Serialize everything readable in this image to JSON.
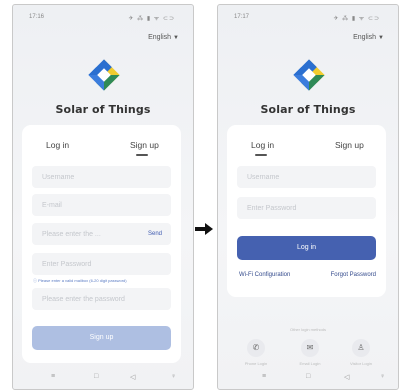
{
  "left_screen": {
    "status_time": "17:16",
    "status_icons": "✈ ⁂ ▮ ᯤ ⊂⊃",
    "language": "English",
    "app_name": "Solar of Things",
    "tabs": {
      "login": "Log in",
      "signup": "Sign up"
    },
    "fields": {
      "username": "Username",
      "email": "E-mail",
      "verification_code": "Please enter the ...",
      "send": "Send",
      "password": "Enter Password",
      "confirm_password": "Please enter the password"
    },
    "hint": "Please enter a valid mailbox (6-20 digit password)",
    "signup_button": "Sign up",
    "nav": {
      "menu": "≡",
      "home": "□",
      "back": "◁",
      "accessibility": "♀"
    }
  },
  "right_screen": {
    "status_time": "17:17",
    "status_icons": "✈ ⁂ ▮ ᯤ ⊂⊃",
    "language": "English",
    "app_name": "Solar of Things",
    "tabs": {
      "login": "Log in",
      "signup": "Sign up"
    },
    "fields": {
      "username": "Username",
      "password": "Enter Password"
    },
    "login_button": "Log in",
    "wifi_config": "Wi-Fi Configuration",
    "forgot_password": "Forgot Password",
    "other_methods": "Other login methods",
    "quick": {
      "phone": "Phone Login",
      "email": "Email Login",
      "visitor": "Visitor Login"
    },
    "nav": {
      "menu": "≡",
      "home": "□",
      "back": "◁",
      "accessibility": "♀"
    }
  },
  "colors": {
    "primary": "#4561b0",
    "primary_light": "#aebfe2",
    "logo_yellow": "#f1cc2f",
    "logo_blue": "#3b7ddd",
    "logo_green": "#2f8a57"
  },
  "icons": {
    "logo": "solar-of-things-logo",
    "arrow": "right-arrow",
    "phone": "phone-icon",
    "email": "mail-icon",
    "visitor": "person-icon"
  }
}
